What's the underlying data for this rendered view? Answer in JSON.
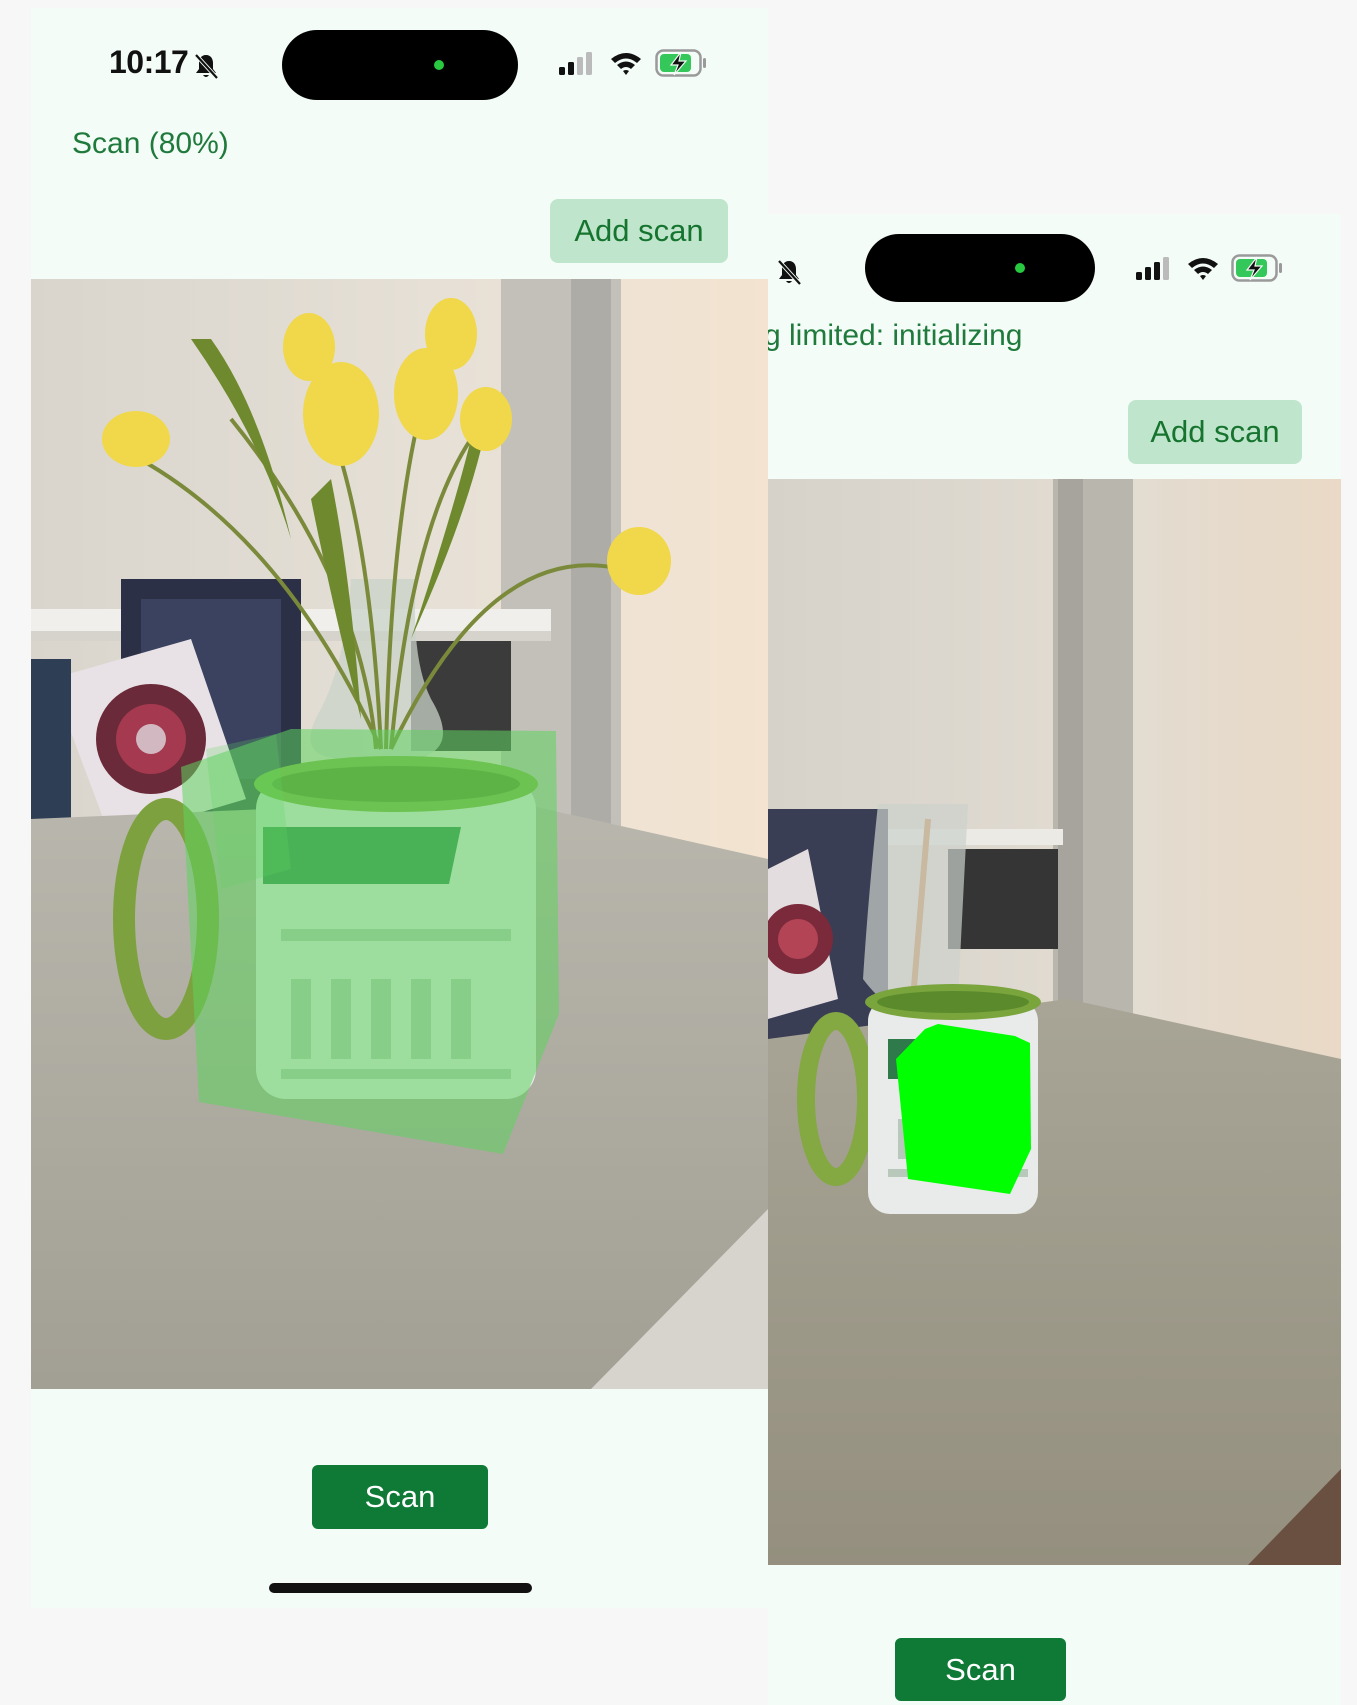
{
  "left_screen": {
    "status_bar": {
      "time": "10:17"
    },
    "scan_status": "Scan (80%)",
    "add_scan_label": "Add scan",
    "scan_button_label": "Scan",
    "overlay_color": "#5fd35f"
  },
  "right_screen": {
    "scan_status": "g limited: initializing",
    "add_scan_label": "Add scan",
    "scan_button_label": "Scan",
    "overlay_color": "#00ff00"
  },
  "colors": {
    "background": "#f4fcf7",
    "accent_text": "#1f7a3c",
    "add_scan_bg": "#bfe6cc",
    "scan_button_bg": "#0e7a35"
  },
  "icons": [
    "bell-slash-icon",
    "cellular-signal-icon",
    "wifi-icon",
    "battery-charging-icon"
  ]
}
